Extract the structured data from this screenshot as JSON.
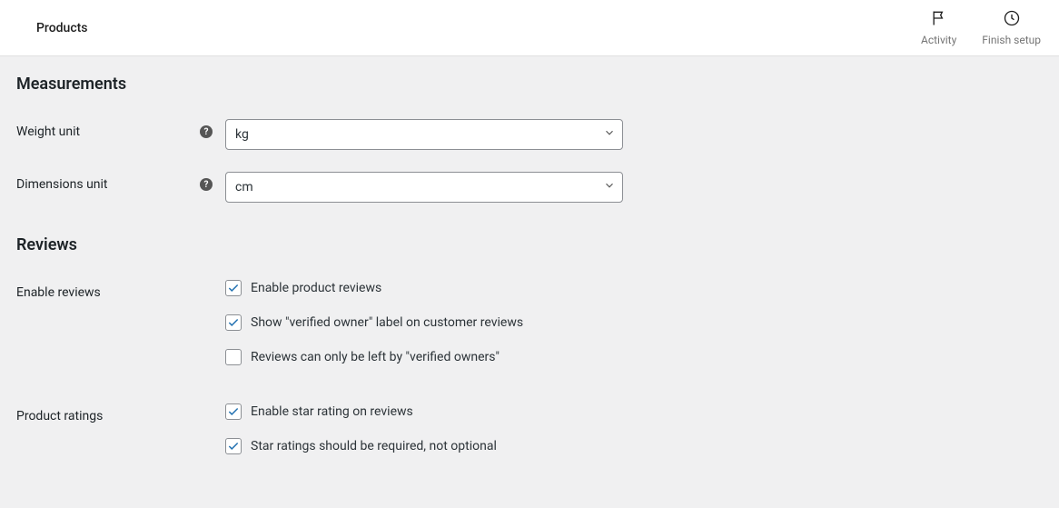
{
  "topbar": {
    "title": "Products",
    "activity_label": "Activity",
    "finish_setup_label": "Finish setup"
  },
  "sections": {
    "measurements": {
      "heading": "Measurements",
      "weight_unit": {
        "label": "Weight unit",
        "value": "kg"
      },
      "dimensions_unit": {
        "label": "Dimensions unit",
        "value": "cm"
      }
    },
    "reviews": {
      "heading": "Reviews",
      "enable_reviews": {
        "label": "Enable reviews",
        "options": [
          {
            "label": "Enable product reviews",
            "checked": true
          },
          {
            "label": "Show \"verified owner\" label on customer reviews",
            "checked": true
          },
          {
            "label": "Reviews can only be left by \"verified owners\"",
            "checked": false
          }
        ]
      },
      "product_ratings": {
        "label": "Product ratings",
        "options": [
          {
            "label": "Enable star rating on reviews",
            "checked": true
          },
          {
            "label": "Star ratings should be required, not optional",
            "checked": true
          }
        ]
      }
    }
  }
}
